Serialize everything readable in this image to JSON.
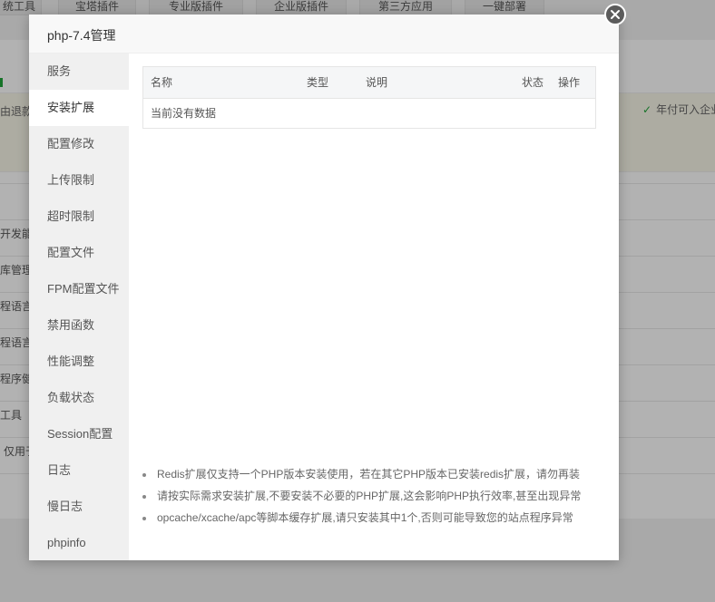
{
  "background": {
    "tabs": [
      "统工具",
      "宝塔插件",
      "专业版插件",
      "企业版插件",
      "第三方应用",
      "一键部署"
    ],
    "notice_left": "由退款",
    "notice_right": "年付可入企业",
    "rows": [
      "开发能力",
      "库管理",
      "程语言",
      "程语言",
      "程序健",
      "工具",
      "仅用于"
    ]
  },
  "modal": {
    "title": "php-7.4管理",
    "close_icon": "close-icon",
    "sidebar": {
      "items": [
        {
          "label": "服务"
        },
        {
          "label": "安装扩展",
          "active": true
        },
        {
          "label": "配置修改"
        },
        {
          "label": "上传限制"
        },
        {
          "label": "超时限制"
        },
        {
          "label": "配置文件"
        },
        {
          "label": "FPM配置文件"
        },
        {
          "label": "禁用函数"
        },
        {
          "label": "性能调整"
        },
        {
          "label": "负载状态"
        },
        {
          "label": "Session配置"
        },
        {
          "label": "日志"
        },
        {
          "label": "慢日志"
        },
        {
          "label": "phpinfo"
        }
      ]
    },
    "table": {
      "headers": {
        "name": "名称",
        "type": "类型",
        "desc": "说明",
        "status": "状态",
        "action": "操作"
      },
      "empty_text": "当前没有数据"
    },
    "notes": [
      "Redis扩展仅支持一个PHP版本安装使用，若在其它PHP版本已安装redis扩展，请勿再装",
      "请按实际需求安装扩展,不要安装不必要的PHP扩展,这会影响PHP执行效率,甚至出现异常",
      "opcache/xcache/apc等脚本缓存扩展,请只安装其中1个,否则可能导致您的站点程序异常"
    ]
  }
}
